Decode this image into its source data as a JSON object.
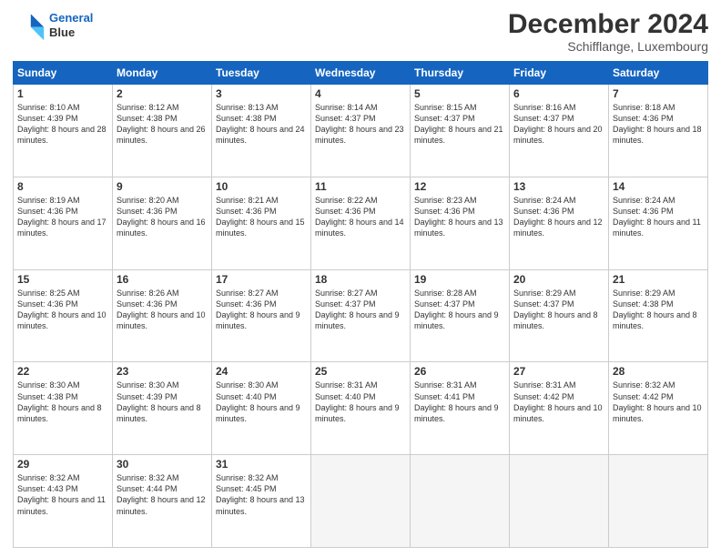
{
  "header": {
    "logo_line1": "General",
    "logo_line2": "Blue",
    "month": "December 2024",
    "location": "Schifflange, Luxembourg"
  },
  "days": [
    "Sunday",
    "Monday",
    "Tuesday",
    "Wednesday",
    "Thursday",
    "Friday",
    "Saturday"
  ],
  "weeks": [
    [
      {
        "num": "1",
        "rise": "8:10 AM",
        "set": "4:39 PM",
        "daylight": "8 hours and 28 minutes."
      },
      {
        "num": "2",
        "rise": "8:12 AM",
        "set": "4:38 PM",
        "daylight": "8 hours and 26 minutes."
      },
      {
        "num": "3",
        "rise": "8:13 AM",
        "set": "4:38 PM",
        "daylight": "8 hours and 24 minutes."
      },
      {
        "num": "4",
        "rise": "8:14 AM",
        "set": "4:37 PM",
        "daylight": "8 hours and 23 minutes."
      },
      {
        "num": "5",
        "rise": "8:15 AM",
        "set": "4:37 PM",
        "daylight": "8 hours and 21 minutes."
      },
      {
        "num": "6",
        "rise": "8:16 AM",
        "set": "4:37 PM",
        "daylight": "8 hours and 20 minutes."
      },
      {
        "num": "7",
        "rise": "8:18 AM",
        "set": "4:36 PM",
        "daylight": "8 hours and 18 minutes."
      }
    ],
    [
      {
        "num": "8",
        "rise": "8:19 AM",
        "set": "4:36 PM",
        "daylight": "8 hours and 17 minutes."
      },
      {
        "num": "9",
        "rise": "8:20 AM",
        "set": "4:36 PM",
        "daylight": "8 hours and 16 minutes."
      },
      {
        "num": "10",
        "rise": "8:21 AM",
        "set": "4:36 PM",
        "daylight": "8 hours and 15 minutes."
      },
      {
        "num": "11",
        "rise": "8:22 AM",
        "set": "4:36 PM",
        "daylight": "8 hours and 14 minutes."
      },
      {
        "num": "12",
        "rise": "8:23 AM",
        "set": "4:36 PM",
        "daylight": "8 hours and 13 minutes."
      },
      {
        "num": "13",
        "rise": "8:24 AM",
        "set": "4:36 PM",
        "daylight": "8 hours and 12 minutes."
      },
      {
        "num": "14",
        "rise": "8:24 AM",
        "set": "4:36 PM",
        "daylight": "8 hours and 11 minutes."
      }
    ],
    [
      {
        "num": "15",
        "rise": "8:25 AM",
        "set": "4:36 PM",
        "daylight": "8 hours and 10 minutes."
      },
      {
        "num": "16",
        "rise": "8:26 AM",
        "set": "4:36 PM",
        "daylight": "8 hours and 10 minutes."
      },
      {
        "num": "17",
        "rise": "8:27 AM",
        "set": "4:36 PM",
        "daylight": "8 hours and 9 minutes."
      },
      {
        "num": "18",
        "rise": "8:27 AM",
        "set": "4:37 PM",
        "daylight": "8 hours and 9 minutes."
      },
      {
        "num": "19",
        "rise": "8:28 AM",
        "set": "4:37 PM",
        "daylight": "8 hours and 9 minutes."
      },
      {
        "num": "20",
        "rise": "8:29 AM",
        "set": "4:37 PM",
        "daylight": "8 hours and 8 minutes."
      },
      {
        "num": "21",
        "rise": "8:29 AM",
        "set": "4:38 PM",
        "daylight": "8 hours and 8 minutes."
      }
    ],
    [
      {
        "num": "22",
        "rise": "8:30 AM",
        "set": "4:38 PM",
        "daylight": "8 hours and 8 minutes."
      },
      {
        "num": "23",
        "rise": "8:30 AM",
        "set": "4:39 PM",
        "daylight": "8 hours and 8 minutes."
      },
      {
        "num": "24",
        "rise": "8:30 AM",
        "set": "4:40 PM",
        "daylight": "8 hours and 9 minutes."
      },
      {
        "num": "25",
        "rise": "8:31 AM",
        "set": "4:40 PM",
        "daylight": "8 hours and 9 minutes."
      },
      {
        "num": "26",
        "rise": "8:31 AM",
        "set": "4:41 PM",
        "daylight": "8 hours and 9 minutes."
      },
      {
        "num": "27",
        "rise": "8:31 AM",
        "set": "4:42 PM",
        "daylight": "8 hours and 10 minutes."
      },
      {
        "num": "28",
        "rise": "8:32 AM",
        "set": "4:42 PM",
        "daylight": "8 hours and 10 minutes."
      }
    ],
    [
      {
        "num": "29",
        "rise": "8:32 AM",
        "set": "4:43 PM",
        "daylight": "8 hours and 11 minutes."
      },
      {
        "num": "30",
        "rise": "8:32 AM",
        "set": "4:44 PM",
        "daylight": "8 hours and 12 minutes."
      },
      {
        "num": "31",
        "rise": "8:32 AM",
        "set": "4:45 PM",
        "daylight": "8 hours and 13 minutes."
      },
      null,
      null,
      null,
      null
    ]
  ],
  "labels": {
    "sunrise": "Sunrise:",
    "sunset": "Sunset:",
    "daylight": "Daylight:"
  }
}
